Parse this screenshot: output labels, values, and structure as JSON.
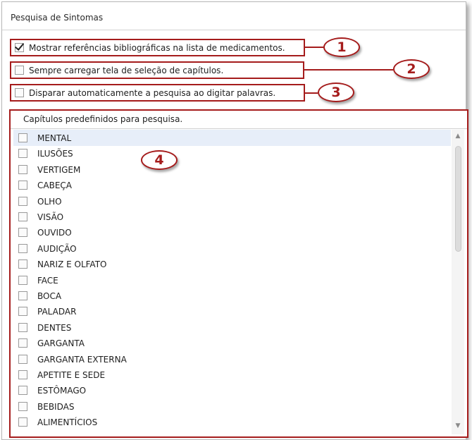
{
  "panel": {
    "title": "Pesquisa de Sintomas"
  },
  "options": [
    {
      "label": "Mostrar referências bibliográficas na lista de medicamentos.",
      "checked": true,
      "callout": "1"
    },
    {
      "label": "Sempre carregar tela de seleção de capítulos.",
      "checked": false,
      "callout": "2"
    },
    {
      "label": "Disparar automaticamente a pesquisa ao digitar palavras.",
      "checked": false,
      "callout": "3"
    }
  ],
  "chapters": {
    "title": "Capítulos predefinidos para pesquisa.",
    "callout": "4",
    "items": [
      "MENTAL",
      "ILUSÕES",
      "VERTIGEM",
      "CABEÇA",
      "OLHO",
      "VISÃO",
      "OUVIDO",
      "AUDIÇÃO",
      "NARIZ E OLFATO",
      "FACE",
      "BOCA",
      "PALADAR",
      "DENTES",
      "GARGANTA",
      "GARGANTA EXTERNA",
      "APETITE E SEDE",
      "ESTÔMAGO",
      "BEBIDAS",
      "ALIMENTÍCIOS"
    ],
    "selected_index": 0
  },
  "scrollbar": {
    "up_glyph": "▲",
    "down_glyph": "▼"
  },
  "colors": {
    "annotation": "#a51c1c",
    "selected_row": "#e7eef9"
  }
}
